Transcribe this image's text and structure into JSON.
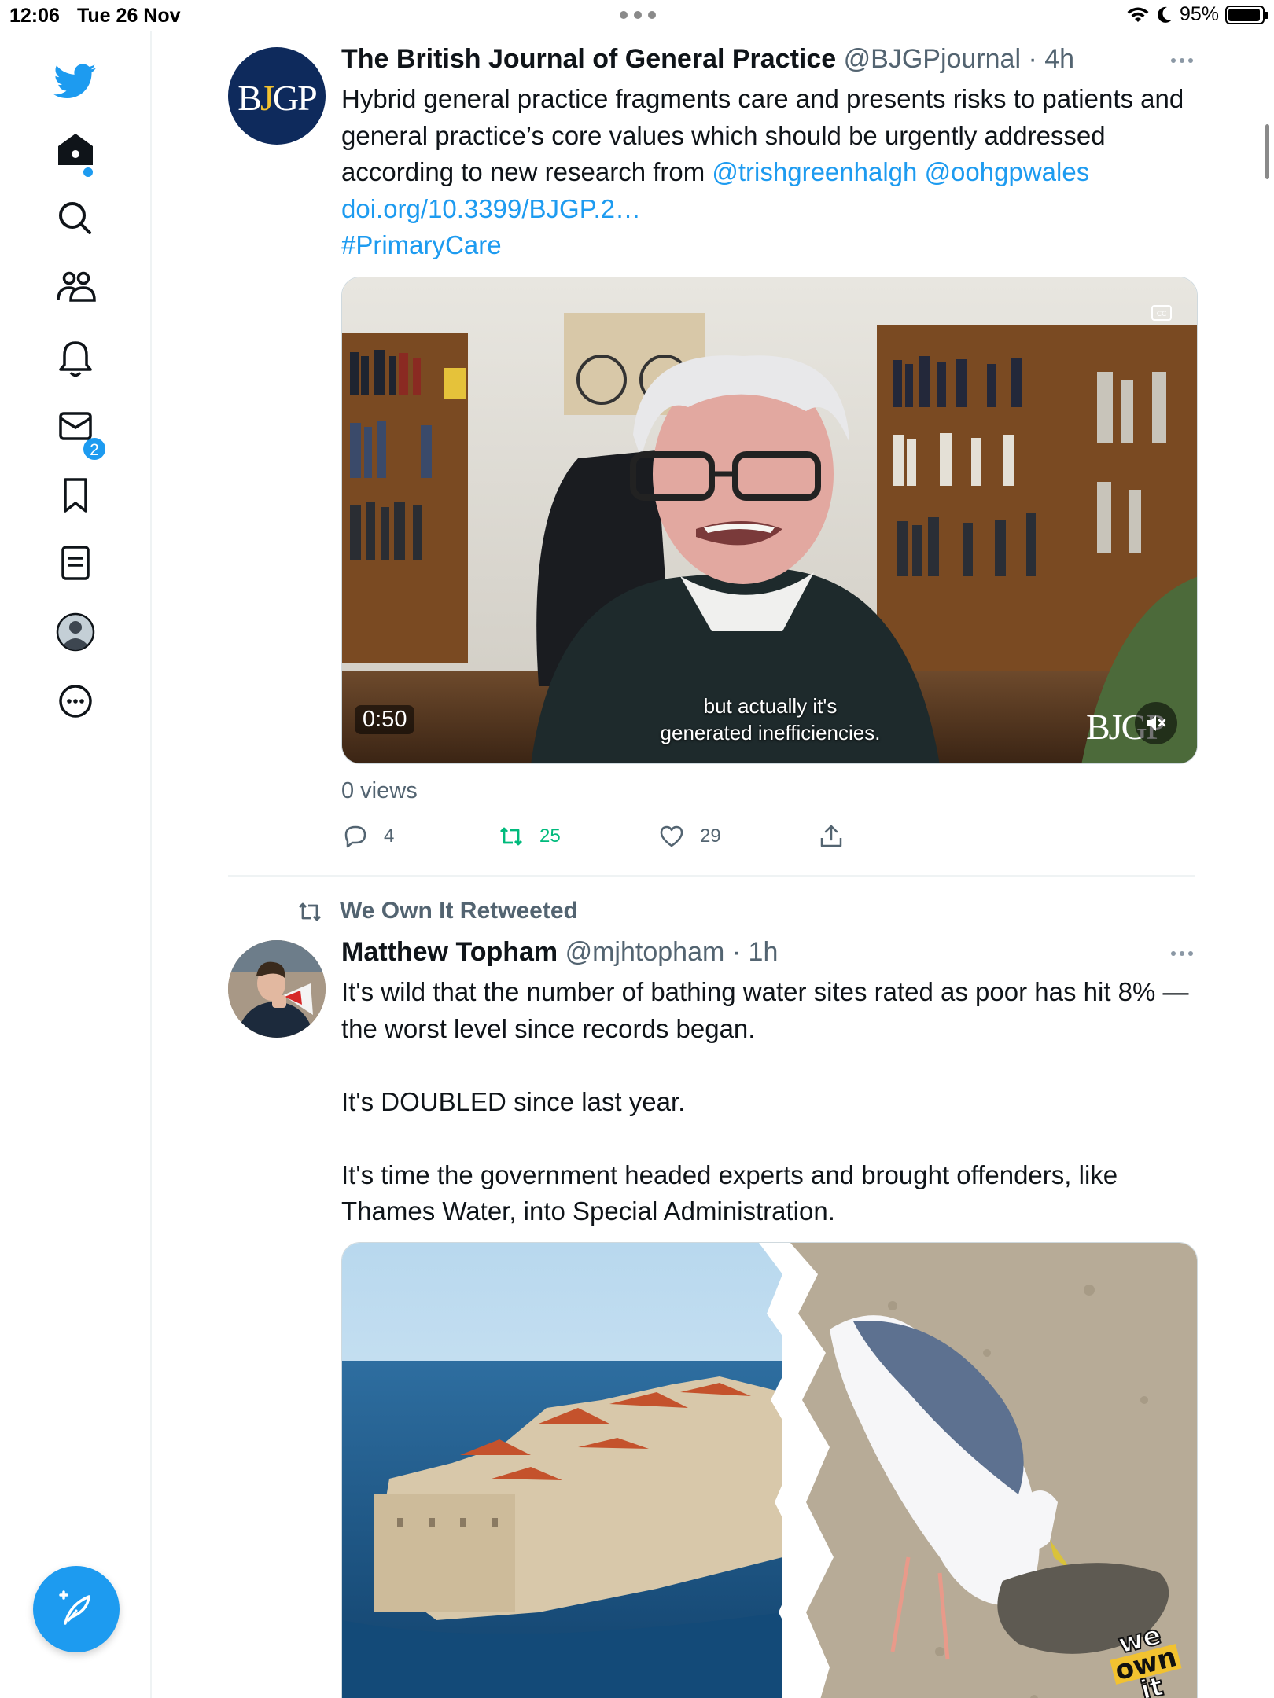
{
  "status_bar": {
    "time": "12:06",
    "date": "Tue 26 Nov",
    "battery": "95%"
  },
  "sidebar": {
    "notifications_badge": "2"
  },
  "tweets": [
    {
      "name": "The British Journal of General Practice",
      "handle": "@BJGPjournal",
      "time": "· 4h",
      "avatar_text": "BJGP",
      "text_plain": "Hybrid general practice fragments care and presents risks to patients and general practice’s core values which should be urgently addressed according to new research from ",
      "mention_1": "@trishgreenhalgh",
      "mention_2": "@oohgpwales",
      "link": "doi.org/10.3399/BJGP.2…",
      "hashtag": "#PrimaryCare",
      "video": {
        "duration": "0:50",
        "caption_line_1": "but actually it's",
        "caption_line_2": "generated inefficiencies.",
        "watermark": "BJGP"
      },
      "views": "0 views",
      "replies": "4",
      "retweets": "25",
      "likes": "29"
    },
    {
      "retweeted_by": "We Own It Retweeted",
      "name": "Matthew Topham",
      "handle": "@mjhtopham",
      "time": "· 1h",
      "para_1": "It's wild that the number of bathing water sites rated as poor has hit 8% — the worst level since records began.",
      "para_2": "It's DOUBLED since last year.",
      "para_3": "It's time the government headed experts and brought offenders, like Thames Water, into Special Administration.",
      "image_logo_line_1": "we",
      "image_logo_line_2": "own",
      "image_logo_line_3": "it"
    }
  ],
  "colors": {
    "accent": "#1d9bf0",
    "retweet_green": "#00ba7c",
    "secondary_text": "#536471",
    "bjgp_navy": "#0e2a5c"
  }
}
